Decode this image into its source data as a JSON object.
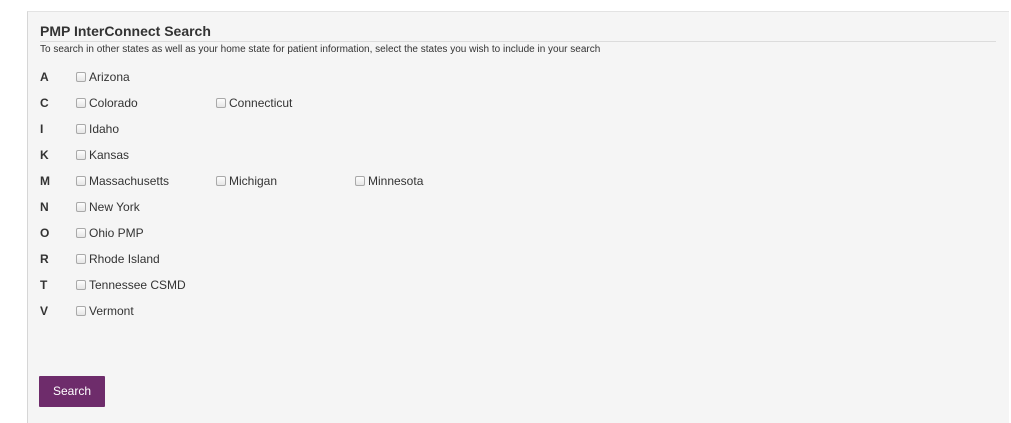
{
  "panel": {
    "title": "PMP InterConnect Search",
    "subtitle": "To search in other states as well as your home state for patient information, select the states you wish to include in your search"
  },
  "state_groups": [
    {
      "letter": "A",
      "states": [
        "Arizona"
      ]
    },
    {
      "letter": "C",
      "states": [
        "Colorado",
        "Connecticut"
      ]
    },
    {
      "letter": "I",
      "states": [
        "Idaho"
      ]
    },
    {
      "letter": "K",
      "states": [
        "Kansas"
      ]
    },
    {
      "letter": "M",
      "states": [
        "Massachusetts",
        "Michigan",
        "Minnesota"
      ]
    },
    {
      "letter": "N",
      "states": [
        "New York"
      ]
    },
    {
      "letter": "O",
      "states": [
        "Ohio PMP"
      ]
    },
    {
      "letter": "R",
      "states": [
        "Rhode Island"
      ]
    },
    {
      "letter": "T",
      "states": [
        "Tennessee CSMD"
      ]
    },
    {
      "letter": "V",
      "states": [
        "Vermont"
      ]
    }
  ],
  "search_button": {
    "label": "Search"
  },
  "colors": {
    "accent": "#6e2c6b",
    "panel_background": "#f5f5f5",
    "text": "#333333"
  }
}
